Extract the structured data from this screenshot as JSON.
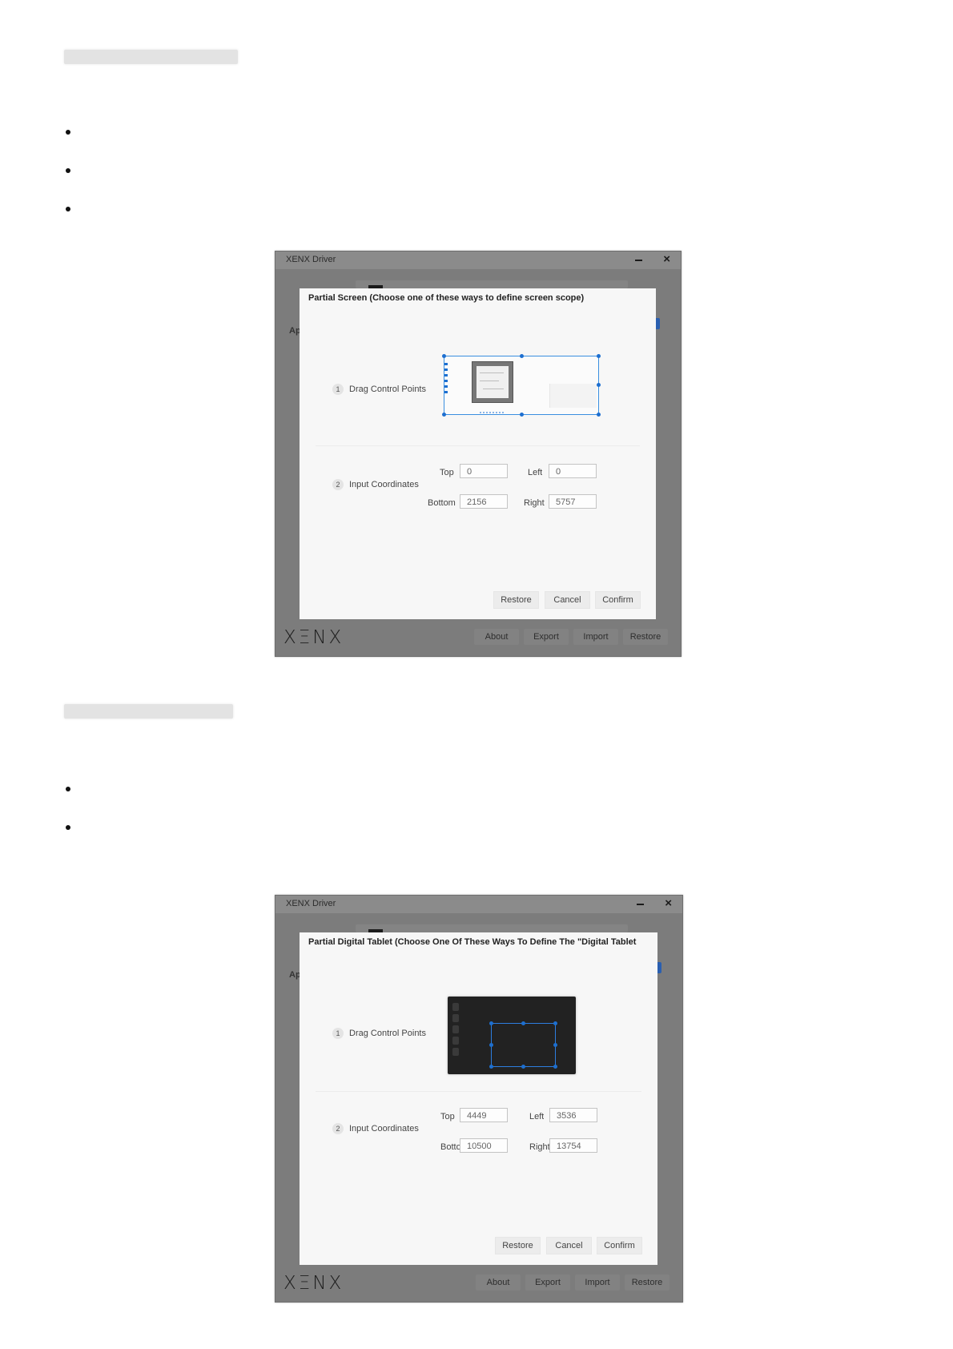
{
  "windows": [
    {
      "title": "XENX Driver",
      "ghost_label": "Ap",
      "logo": "XΞNX",
      "footer_buttons": [
        "About",
        "Export",
        "Import",
        "Restore"
      ],
      "dialog": {
        "title": "Partial Screen (Choose one of these ways to define screen scope)",
        "step1": {
          "num": "1",
          "label": "Drag Control Points"
        },
        "step2": {
          "num": "2",
          "label": "Input Coordinates"
        },
        "fields": {
          "top": {
            "label": "Top",
            "value": "0"
          },
          "left": {
            "label": "Left",
            "value": "0"
          },
          "bottom": {
            "label": "Bottom",
            "value": "2156"
          },
          "right": {
            "label": "Right",
            "value": "5757"
          }
        },
        "buttons": {
          "restore": "Restore",
          "cancel": "Cancel",
          "confirm": "Confirm"
        }
      }
    },
    {
      "title": "XENX Driver",
      "ghost_label": "Ap",
      "logo": "XΞNX",
      "footer_buttons": [
        "About",
        "Export",
        "Import",
        "Restore"
      ],
      "dialog": {
        "title": "Partial Digital Tablet (Choose One Of These Ways To Define The \"Digital Tablet",
        "step1": {
          "num": "1",
          "label": "Drag Control Points"
        },
        "step2": {
          "num": "2",
          "label": "Input Coordinates"
        },
        "fields": {
          "top": {
            "label": "Top",
            "value": "4449"
          },
          "left": {
            "label": "Left",
            "value": "3536"
          },
          "bottom": {
            "label": "Bottom",
            "value": "10500"
          },
          "right": {
            "label": "Right",
            "value": "13754"
          }
        },
        "buttons": {
          "restore": "Restore",
          "cancel": "Cancel",
          "confirm": "Confirm"
        }
      }
    }
  ],
  "colors": {
    "accent": "#1d6fd0",
    "window_frame": "#7c7c7c",
    "dialog_bg": "#f7f7f7"
  }
}
